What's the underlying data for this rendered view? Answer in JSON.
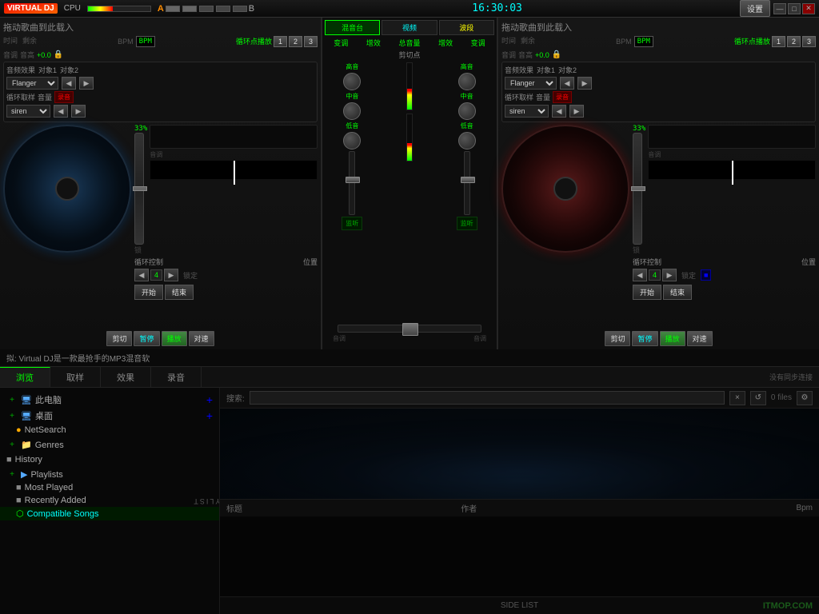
{
  "titlebar": {
    "logo": "VIRTUAL DJ",
    "cpu_label": "CPU",
    "time": "16:30:03",
    "settings_btn": "设置",
    "win_minimize": "—",
    "win_restore": "□",
    "win_close": "✕"
  },
  "mixer_tabs": {
    "tab1": "混音台",
    "tab2": "视频",
    "tab3": "波段"
  },
  "mixer_channel_labels": {
    "fx1": "变调",
    "fx2": "增效",
    "vol": "总音量",
    "fx3": "增效",
    "fx4": "变调",
    "cutpoint": "剪切点",
    "high_l": "高音",
    "mid_l": "中音",
    "low_l": "低音",
    "high_r": "高音",
    "mid_r": "中音",
    "low_r": "低音",
    "monitor_l": "监听",
    "monitor_r": "监听",
    "tone_l": "音调",
    "tone_r": "音调"
  },
  "deck_left": {
    "title": "拖动歌曲到此载入",
    "bpm_label": "BPM",
    "loop_label": "循环点播放",
    "loop_btn1": "1",
    "loop_btn2": "2",
    "loop_btn3": "3",
    "time_label": "时间",
    "remain_label": "剩余",
    "pitch_label": "音调",
    "volume_label": "音高",
    "volume_value": "+0.0",
    "percent": "33%",
    "lock_label": "锁",
    "fx_label": "音频效果",
    "target1": "对象1",
    "target2": "对象2",
    "fx_select": "Flanger",
    "loop_sample": "循环取样",
    "vol_label": "音量",
    "rec_label": "录音",
    "siren": "siren",
    "loop_control": "循环控制",
    "position": "位置",
    "loop_num": "4",
    "lock_btn": "锁定",
    "start_btn": "开始",
    "end_btn": "结束",
    "cut_btn": "剪切",
    "pause_btn": "暂停",
    "play_btn": "播放",
    "speed_btn": "对速"
  },
  "deck_right": {
    "title": "拖动歌曲到此载入",
    "bpm_label": "BPM",
    "loop_label": "循环点播放",
    "loop_btn1": "1",
    "loop_btn2": "2",
    "loop_btn3": "3",
    "time_label": "时间",
    "remain_label": "剩余",
    "pitch_label": "音调",
    "volume_label": "音高",
    "volume_value": "+0.0",
    "percent": "33%",
    "lock_label": "锁",
    "fx_label": "音频效果",
    "target1": "对象1",
    "target2": "对象2",
    "fx_select": "Flanger",
    "loop_sample": "循环取样",
    "vol_label": "音量",
    "rec_label": "录音",
    "siren": "siren",
    "loop_control": "循环控制",
    "position": "位置",
    "loop_num": "4",
    "lock_btn": "锁定",
    "start_btn": "开始",
    "end_btn": "结束",
    "cut_btn": "剪切",
    "pause_btn": "暂停",
    "play_btn": "播放",
    "speed_btn": "对速"
  },
  "info_bar": {
    "text": "拟: Virtual DJ是一款最抢手的MP3混音软"
  },
  "tabs": [
    {
      "id": "browse",
      "label": "浏览",
      "active": true
    },
    {
      "id": "sample",
      "label": "取样",
      "active": false
    },
    {
      "id": "effects",
      "label": "效果",
      "active": false
    },
    {
      "id": "record",
      "label": "录音",
      "active": false
    }
  ],
  "tab_right_text": "没有同步连接",
  "search": {
    "label": "搜索:",
    "placeholder": "",
    "files_count": "0 files"
  },
  "sidebar": {
    "items": [
      {
        "id": "this-pc",
        "icon": "+",
        "label": "此电脑",
        "indent": 0,
        "type": "expandable"
      },
      {
        "id": "desktop",
        "icon": "+",
        "label": "桌面",
        "indent": 0,
        "type": "expandable"
      },
      {
        "id": "netsearch",
        "icon": "●",
        "label": "NetSearch",
        "indent": 1,
        "type": "item"
      },
      {
        "id": "genres",
        "icon": "+",
        "label": "Genres",
        "indent": 0,
        "type": "expandable"
      },
      {
        "id": "history",
        "icon": "■",
        "label": "History",
        "indent": 0,
        "type": "item"
      },
      {
        "id": "playlists",
        "icon": "+",
        "label": "Playlists",
        "indent": 0,
        "type": "expandable"
      },
      {
        "id": "most-played",
        "icon": "■",
        "label": "Most Played",
        "indent": 1,
        "type": "item"
      },
      {
        "id": "recently-added",
        "icon": "■",
        "label": "Recently Added",
        "indent": 1,
        "type": "item"
      },
      {
        "id": "compatible-songs",
        "icon": "⬡",
        "label": "Compatible Songs",
        "indent": 1,
        "type": "item",
        "selected": true
      }
    ]
  },
  "table_headers": {
    "title": "标题",
    "author": "作者",
    "bpm": "Bpm"
  },
  "bottom_status": {
    "label": "SIDE LIST"
  },
  "watermark": "ITMOP.COM",
  "playlist_label": "PLAYLIST"
}
